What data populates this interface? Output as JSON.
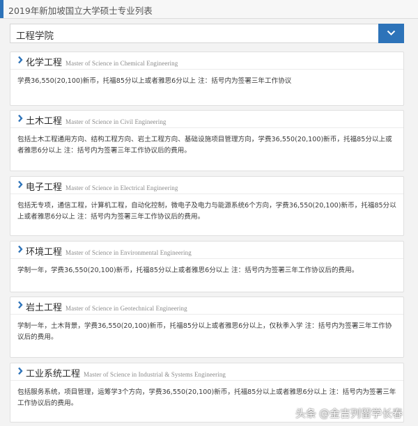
{
  "page": {
    "title": "2019年新加坡国立大学硕士专业列表",
    "accent_color": "#2d73b9"
  },
  "dropdown": {
    "selected": "工程学院",
    "icon": "chevron-down-icon"
  },
  "programs": [
    {
      "name": "化学工程",
      "english": "Master of Science in Chemical Engineering",
      "description": "学费36,550(20,100)新币，托福85分以上或者雅思6分以上 注：括号内为签署三年工作协议"
    },
    {
      "name": "土木工程",
      "english": "Master of Science in Civil Engineering",
      "description": "包括土木工程通用方向、结构工程方向、岩土工程方向、基础设施项目管理方向，学费36,550(20,100)新币，托福85分以上或者雅思6分以上 注：括号内为签署三年工作协议后的费用。"
    },
    {
      "name": "电子工程",
      "english": "Master of Science in Electrical Engineering",
      "description": "包括无专项，通信工程，计算机工程，自动化控制，微电子及电力与能源系统6个方向，学费36,550(20,100)新币，托福85分以上或者雅思6分以上 注：括号内为签署三年工作协议后的费用。"
    },
    {
      "name": "环境工程",
      "english": "Master of Science in Environmental Engineering",
      "description": "学制一年，学费36,550(20,100)新币，托福85分以上或者雅思6分以上 注：括号内为签署三年工作协议后的费用。"
    },
    {
      "name": "岩土工程",
      "english": "Master of Science in Geotechnical Engineering",
      "description": "学制一年，土木背景，学费36,550(20,100)新币，托福85分以上或者雅思6分以上，仅秋季入学 注：括号内为签署三年工作协议后的费用。"
    },
    {
      "name": "工业系统工程",
      "english": "Master of Science in Industrial & Systems Engineering",
      "description": "包括服务系统，项目管理，运筹学3个方向，学费36,550(20,100)新币，托福85分以上或者雅思6分以上 注：括号内为签署三年工作协议后的费用。"
    }
  ],
  "watermark": {
    "prefix": "头条",
    "handle": "@金吉列留学长春"
  }
}
